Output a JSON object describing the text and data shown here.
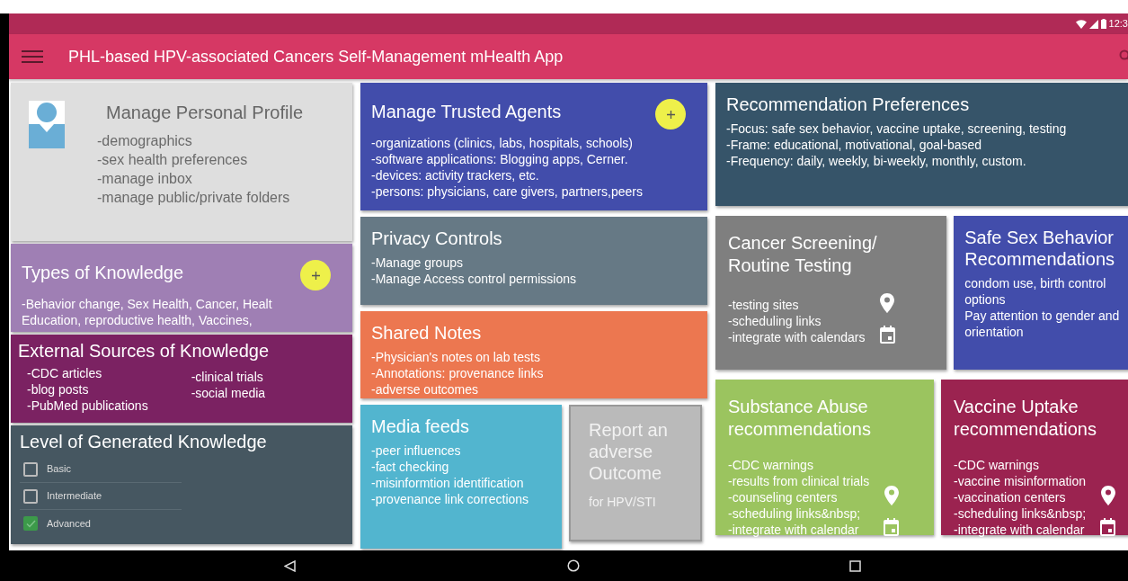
{
  "status_bar": {
    "time": "12:3"
  },
  "app_bar": {
    "title": "PHL-based HPV-associated Cancers Self-Management mHealth App"
  },
  "columns": [
    {
      "rows": [
        {
          "cards": [
            {
              "kind": "profile",
              "color": "#dedede",
              "title": "Manage Personal Profile",
              "items": [
                "-demographics",
                "-sex health preferences",
                "-manage inbox",
                "-manage public/private folders"
              ]
            }
          ]
        },
        {
          "cards": [
            {
              "kind": "list",
              "color": "#9f7fb4",
              "title": "Types of Knowledge",
              "add_button": true,
              "items": [
                "-Behavior change, Sex Health, Cancer, Healt",
                "Education, reproductive health, Vaccines,"
              ]
            }
          ]
        },
        {
          "cards": [
            {
              "kind": "two_column",
              "color": "#7b2262",
              "title": "External Sources of Knowledge",
              "columns": [
                [
                  "-CDC articles",
                  "-blog posts",
                  "-PubMed publications"
                ],
                [
                  "-clinical trials",
                  "-social media"
                ]
              ]
            }
          ]
        },
        {
          "cards": [
            {
              "kind": "checklist",
              "color": "#465761",
              "title": "Level of Generated Knowledge",
              "options": [
                {
                  "label": "Basic",
                  "checked": false
                },
                {
                  "label": "Intermediate",
                  "checked": false
                },
                {
                  "label": "Advanced",
                  "checked": true
                }
              ]
            }
          ]
        }
      ]
    },
    {
      "rows": [
        {
          "cards": [
            {
              "kind": "list",
              "color": "#424dab",
              "title": "Manage Trusted Agents",
              "add_button": true,
              "items": [
                "-organizations (clinics, labs, hospitals, schools)",
                "-software applications: Blogging apps, Cerner.",
                "-devices: activity trackers, etc.",
                "-persons: physicians, care givers, partners,peers"
              ]
            }
          ]
        },
        {
          "cards": [
            {
              "kind": "list",
              "color": "#667985",
              "title": "Privacy Controls",
              "items": [
                "-Manage groups",
                "-Manage Access control permissions"
              ]
            }
          ]
        },
        {
          "cards": [
            {
              "kind": "list",
              "color": "#ec7750",
              "title": "Shared Notes",
              "items": [
                "-Physician's notes on lab tests",
                "-Annotations: provenance links",
                "-adverse outcomes"
              ]
            }
          ]
        },
        {
          "cards": [
            {
              "kind": "list",
              "color": "#52b5cf",
              "title": "Media feeds",
              "items": [
                "-peer influences",
                "-fact checking",
                "-misinformtion identification",
                "-provenance link corrections"
              ]
            },
            {
              "kind": "report",
              "color": "#bababa",
              "title": "Report an adverse Outcome",
              "items": [
                "for HPV/STI"
              ]
            }
          ]
        }
      ]
    },
    {
      "rows": [
        {
          "cards": [
            {
              "kind": "list",
              "color": "#365469",
              "title": "Recommendation Preferences",
              "items": [
                "-Focus: safe sex behavior, vaccine uptake, screening, testing",
                "-Frame: educational, motivational, goal-based",
                "-Frequency: daily, weekly, bi-weekly, monthly, custom."
              ]
            }
          ]
        },
        {
          "cards": [
            {
              "kind": "icon_list",
              "color": "#7f7f7f",
              "title": "Cancer Screening/ Routine Testing",
              "items": [
                "-testing sites",
                "-scheduling links",
                "-integrate with calendars"
              ]
            },
            {
              "kind": "list",
              "color": "#424dab",
              "title": "Safe Sex Behavior Recommendations",
              "items": [
                "condom use, birth control options",
                "Pay attention to gender and orientation"
              ]
            }
          ]
        },
        {
          "cards": [
            {
              "kind": "icon_list",
              "color": "#9bc45f",
              "title": "Substance Abuse recommendations",
              "items": [
                "-CDC warnings",
                "-results from clinical trials",
                "-counseling centers",
                "-scheduling links&nbsp;",
                "-integrate with calendar"
              ]
            },
            {
              "kind": "icon_list",
              "color": "#9b2350",
              "title": "Vaccine Uptake recommendations",
              "items": [
                "-CDC warnings",
                "-vaccine misinformation",
                "-vaccination centers",
                "-scheduling links&nbsp;",
                "-integrate with calendar"
              ]
            }
          ]
        }
      ]
    }
  ]
}
